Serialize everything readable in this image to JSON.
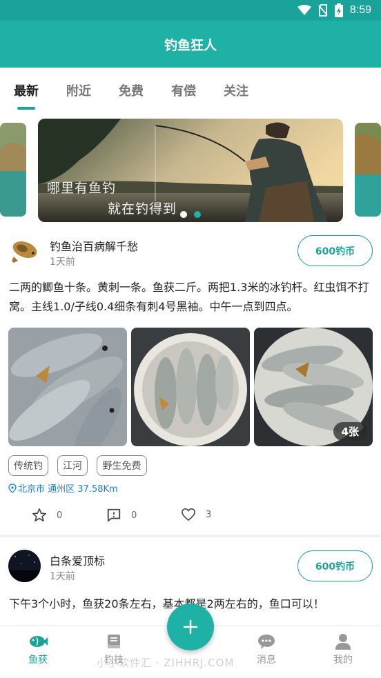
{
  "status_bar": {
    "time": "8:59"
  },
  "app_bar": {
    "title": "钓鱼狂人"
  },
  "tabs": [
    {
      "label": "最新",
      "active": true
    },
    {
      "label": "附近",
      "active": false
    },
    {
      "label": "免费",
      "active": false
    },
    {
      "label": "有偿",
      "active": false
    },
    {
      "label": "关注",
      "active": false
    }
  ],
  "banner": {
    "line1": "哪里有鱼钓",
    "line2": "就在钓得到",
    "page_count": 2,
    "active_page": 2
  },
  "posts": [
    {
      "username": "钓鱼治百病解千愁",
      "time": "1天前",
      "coin_label": "600钓币",
      "text": "二两的鲫鱼十条。黄刺一条。鱼获二斤。两把1.3米的冰钓杆。红虫饵不打窝。主线1.0/子线0.4细条有刺4号黑袖。中午一点到四点。",
      "photo_count_label": "4张",
      "tags": [
        "传统钓",
        "江河",
        "野生免费"
      ],
      "location": "北京市 通州区 37.58Km",
      "actions": {
        "favorites": "0",
        "comments": "0",
        "likes": "3"
      }
    },
    {
      "username": "白条爱顶标",
      "time": "1天前",
      "coin_label": "600钓币",
      "text": "下午3个小时，鱼获20条左右，基本都是2两左右的，鱼口可以！"
    }
  ],
  "bottom_nav": [
    {
      "label": "鱼获",
      "icon": "fish-icon",
      "active": true
    },
    {
      "label": "钓技",
      "icon": "book-icon",
      "active": false
    },
    {
      "label": "消息",
      "icon": "chat-icon",
      "active": false
    },
    {
      "label": "我的",
      "icon": "person-icon",
      "active": false
    }
  ],
  "fab": {
    "icon": "plus-icon"
  },
  "watermark": "小小软件汇 · ZIHHRJ.COM",
  "colors": {
    "primary": "#1fb1a6",
    "primary_dark": "#1aa39a",
    "link": "#1a7fd1"
  }
}
